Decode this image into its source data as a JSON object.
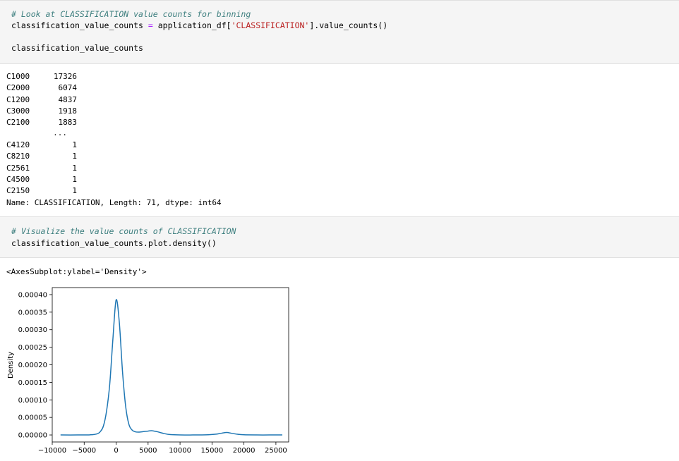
{
  "cell1": {
    "comment": "# Look at CLASSIFICATION value counts for binning",
    "line2_var": "classification_value_counts",
    "line2_eq": " = ",
    "line2_call": "application_df[",
    "line2_str": "'CLASSIFICATION'",
    "line2_tail": "].value_counts()",
    "line4": "classification_value_counts"
  },
  "output1": {
    "rows_top": [
      {
        "key": "C1000",
        "value": "17326"
      },
      {
        "key": "C2000",
        "value": "6074"
      },
      {
        "key": "C1200",
        "value": "4837"
      },
      {
        "key": "C3000",
        "value": "1918"
      },
      {
        "key": "C2100",
        "value": "1883"
      }
    ],
    "ellipsis": "...",
    "rows_bottom": [
      {
        "key": "C4120",
        "value": "1"
      },
      {
        "key": "C8210",
        "value": "1"
      },
      {
        "key": "C2561",
        "value": "1"
      },
      {
        "key": "C4500",
        "value": "1"
      },
      {
        "key": "C2150",
        "value": "1"
      }
    ],
    "footer": "Name: CLASSIFICATION, Length: 71, dtype: int64"
  },
  "cell2": {
    "comment": "# Visualize the value counts of CLASSIFICATION",
    "line2": "classification_value_counts.plot.density()"
  },
  "output2": {
    "repr": "<AxesSubplot:ylabel='Density'>"
  },
  "chart_data": {
    "type": "line",
    "title": "",
    "xlabel": "",
    "ylabel": "Density",
    "xlim": [
      -10000,
      27000
    ],
    "ylim": [
      -2e-05,
      0.00042
    ],
    "xticks": [
      "−10000",
      "−5000",
      "0",
      "5000",
      "10000",
      "15000",
      "20000",
      "25000"
    ],
    "xtick_values": [
      -10000,
      -5000,
      0,
      5000,
      10000,
      15000,
      20000,
      25000
    ],
    "yticks": [
      "0.00000",
      "0.00005",
      "0.00010",
      "0.00015",
      "0.00020",
      "0.00025",
      "0.00030",
      "0.00035",
      "0.00040"
    ],
    "ytick_values": [
      0,
      5e-05,
      0.0001,
      0.00015,
      0.0002,
      0.00025,
      0.0003,
      0.00035,
      0.0004
    ],
    "line_color": "#1f77b4",
    "series": [
      {
        "x": [
          -8700,
          -6000,
          -4000,
          -3000,
          -2500,
          -2000,
          -1500,
          -1000,
          -500,
          0,
          500,
          1000,
          1500,
          2000,
          2500,
          3000,
          3500,
          4000,
          5000,
          5600,
          6500,
          7500,
          8500,
          10000,
          12000,
          14000,
          15500,
          16500,
          17300,
          18000,
          19000,
          20000,
          22000,
          24000,
          26000
        ],
        "y": [
          0,
          0,
          5e-07,
          3e-06,
          9e-06,
          2.5e-05,
          6.8e-05,
          0.000145,
          0.000275,
          0.000385,
          0.00032,
          0.00018,
          8e-05,
          3e-05,
          1.4e-05,
          9e-06,
          8e-06,
          9e-06,
          1.1e-05,
          1.2e-05,
          9e-06,
          4e-06,
          1e-06,
          0,
          0,
          3e-07,
          2e-06,
          5e-06,
          7e-06,
          5e-06,
          2e-06,
          5e-07,
          0,
          0,
          0
        ]
      }
    ]
  }
}
